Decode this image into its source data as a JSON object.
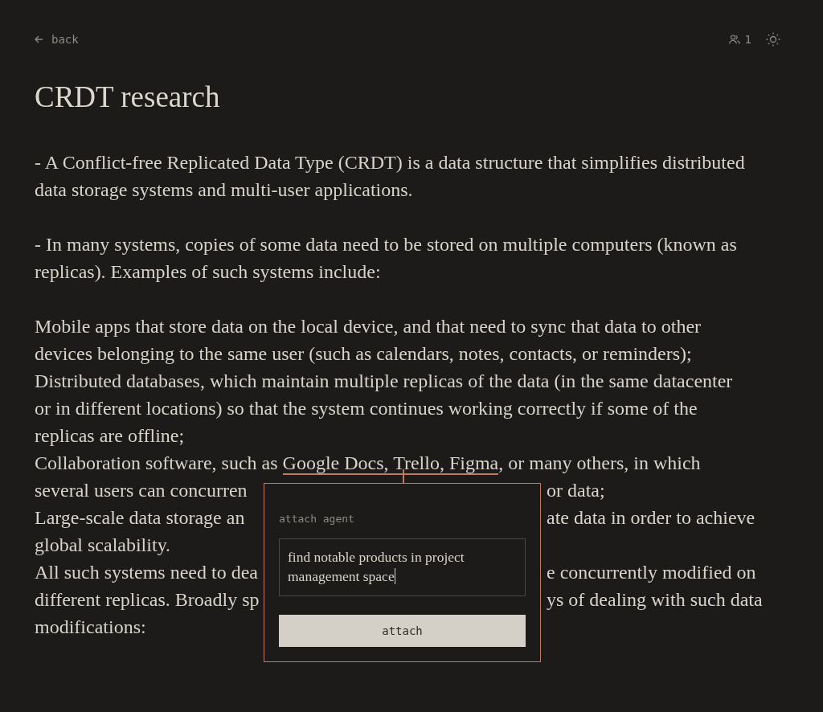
{
  "header": {
    "back": "back",
    "users_count": "1"
  },
  "title": "CRDT research",
  "paragraphs": [
    {
      "lines": [
        {
          "text": "- A Conflict-free Replicated Data Type (CRDT) is a data structure that simplifies distributed"
        },
        {
          "text": "data storage systems and multi-user applications."
        }
      ]
    },
    {
      "lines": [
        {
          "text": "- In many systems, copies of some data need to be stored on multiple computers (known as"
        },
        {
          "text": "replicas). Examples of such systems include:"
        }
      ]
    },
    {
      "lines": [
        {
          "text": "Mobile apps that store data on the local device, and that need to sync that data to other"
        },
        {
          "text": "devices belonging to the same user (such as calendars, notes, contacts, or reminders);"
        },
        {
          "text": "Distributed databases, which maintain multiple replicas of the data (in the same datacenter"
        },
        {
          "text": "or in different locations) so that the system continues working correctly if some of the"
        },
        {
          "text": "replicas are offline;"
        },
        {
          "before": "Collaboration software, such as ",
          "highlight": "Google Docs, Trello, Figma",
          "after": ", or many others, in which"
        },
        {
          "left": "several users can concurren",
          "right": "or data;"
        },
        {
          "left": "Large-scale data storage an",
          "right": "ate data in order to achieve"
        },
        {
          "text": "global scalability."
        },
        {
          "left": "All such systems need to dea",
          "right": "e concurrently modified on"
        },
        {
          "left": "different replicas. Broadly sp",
          "right": "ys of dealing with such data"
        },
        {
          "text": "modifications:"
        }
      ]
    }
  ],
  "popup": {
    "label": "attach agent",
    "input_value": "find notable products in project management space",
    "button": "attach"
  }
}
